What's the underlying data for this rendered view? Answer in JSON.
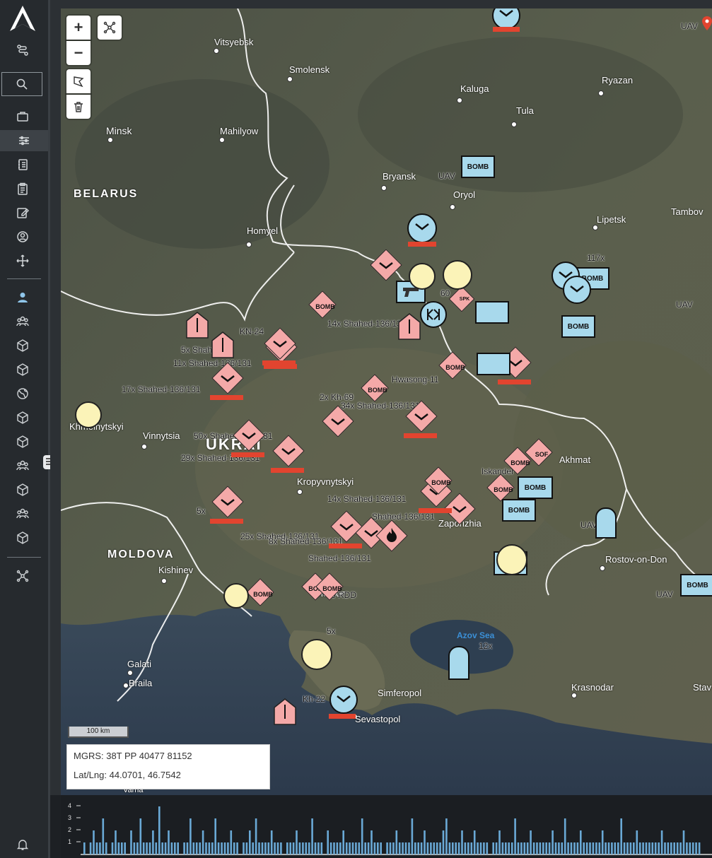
{
  "map": {
    "zoom_in_label": "+",
    "zoom_out_label": "−",
    "scale_label": "100 km",
    "mgrs": "MGRS: 38T PP 40477 81152",
    "latlng": "Lat/Lng: 44.0701, 46.7542",
    "country_labels": [
      "BELARUS",
      "UKRAI",
      "MOLDOVA"
    ],
    "sea_label": "Azov Sea",
    "cities": [
      "Vitsyebsk",
      "Smolensk",
      "Kaluga",
      "Ryazan",
      "Tula",
      "Minsk",
      "Mahilyow",
      "Bryansk",
      "Oryol",
      "Lipetsk",
      "Tambov",
      "Homyel",
      "Khmelnytskyi",
      "Vinnytsia",
      "Kropyvnytskyi",
      "Kherson",
      "Kishinev",
      "Galati",
      "Braila",
      "Zaporizhia",
      "Krasnodar",
      "Stav",
      "Sevastopol",
      "Simferopol",
      "Varna",
      "Rostov-on-Don",
      "Akhmat"
    ],
    "event_labels": [
      "17x Shahed-136/131",
      "29x Shahed-136/131",
      "25x Shahed-136/131",
      "14x Shahed-136/131",
      "34x Shahed-136/131",
      "11x Shahed-136/131",
      "14x Shahed-136/131",
      "2x Kh-69",
      "Shahed-136/131",
      "Shahed-136/131",
      "5x",
      "5x",
      "117x",
      "12x",
      "Kh-22",
      "UAV",
      "UAV",
      "UAV",
      "UAV",
      "UAV",
      "KN-24",
      "Hwasong-11",
      "60",
      "Iskander",
      "6 RDD",
      "5x Shahed",
      "50x Shahed-136/131",
      "8x Shahed-136/131"
    ],
    "symbol_text": [
      "BOMB",
      "BOMB",
      "BOMB",
      "BOMB",
      "BOMB",
      "BOMB",
      "BOMB",
      "BOMB",
      "BOMB",
      "BOMB",
      "BOMB",
      "BOMB",
      "SOF",
      "SPK"
    ]
  },
  "timeline": {
    "y_ticks": [
      "4",
      "3",
      "2",
      "1"
    ],
    "counts": [
      1,
      0,
      1,
      2,
      1,
      1,
      3,
      1,
      0,
      1,
      2,
      1,
      1,
      1,
      0,
      2,
      1,
      1,
      3,
      1,
      1,
      1,
      2,
      1,
      4,
      1,
      1,
      2,
      1,
      1,
      1,
      0,
      1,
      1,
      3,
      1,
      1,
      1,
      2,
      1,
      1,
      1,
      3,
      1,
      1,
      1,
      1,
      2,
      1,
      1,
      0,
      1,
      1,
      2,
      1,
      3,
      1,
      1,
      1,
      1,
      2,
      1,
      1,
      1,
      0,
      1,
      1,
      1,
      2,
      1,
      1,
      1,
      1,
      3,
      1,
      1,
      1,
      0,
      2,
      1,
      1,
      1,
      1,
      2,
      1,
      1,
      1,
      1,
      1,
      3,
      1,
      1,
      2,
      1,
      1,
      1,
      0,
      1,
      1,
      1,
      2,
      1,
      1,
      1,
      1,
      3,
      1,
      1,
      1,
      2,
      1,
      1,
      1,
      1,
      1,
      2,
      3,
      1,
      1,
      1,
      1,
      2,
      1,
      1,
      1,
      2,
      1,
      1,
      1,
      1,
      0,
      1,
      1,
      2,
      1,
      1,
      1,
      1,
      3,
      1,
      1,
      1,
      1,
      2,
      1,
      1,
      1,
      1,
      1,
      1,
      2,
      1,
      1,
      1,
      3,
      1,
      1,
      1,
      1,
      2,
      1,
      1,
      1,
      1,
      1,
      1,
      2,
      1,
      1,
      1,
      1,
      1,
      3,
      1,
      1,
      1,
      1,
      2,
      1,
      1,
      1,
      1,
      1,
      1,
      1,
      2,
      1,
      1,
      1,
      1,
      1,
      1,
      2,
      1,
      1,
      1,
      1,
      1,
      0,
      0
    ]
  },
  "colors": {
    "hostile": "#f4a9a8",
    "friendly": "#a8d9ec",
    "alert_bar": "#e2442f",
    "timeline_bar": "#6aa9d6"
  }
}
